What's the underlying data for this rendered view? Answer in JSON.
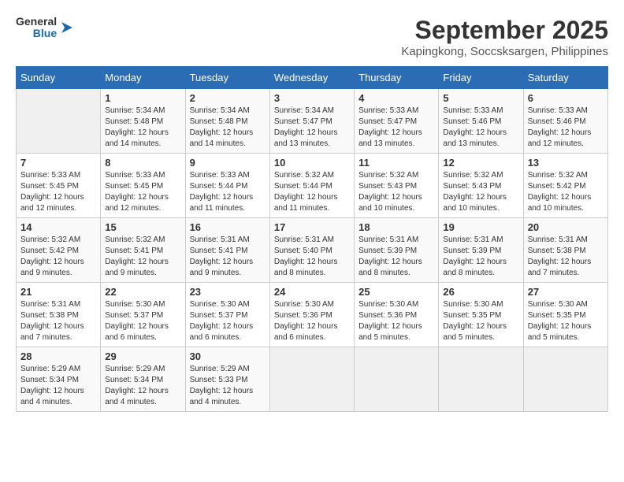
{
  "header": {
    "logo_line1": "General",
    "logo_line2": "Blue",
    "month": "September 2025",
    "location": "Kapingkong, Soccsksargen, Philippines"
  },
  "weekdays": [
    "Sunday",
    "Monday",
    "Tuesday",
    "Wednesday",
    "Thursday",
    "Friday",
    "Saturday"
  ],
  "weeks": [
    [
      {
        "day": "",
        "sunrise": "",
        "sunset": "",
        "daylight": ""
      },
      {
        "day": "1",
        "sunrise": "5:34 AM",
        "sunset": "5:48 PM",
        "daylight": "12 hours and 14 minutes."
      },
      {
        "day": "2",
        "sunrise": "5:34 AM",
        "sunset": "5:48 PM",
        "daylight": "12 hours and 14 minutes."
      },
      {
        "day": "3",
        "sunrise": "5:34 AM",
        "sunset": "5:47 PM",
        "daylight": "12 hours and 13 minutes."
      },
      {
        "day": "4",
        "sunrise": "5:33 AM",
        "sunset": "5:47 PM",
        "daylight": "12 hours and 13 minutes."
      },
      {
        "day": "5",
        "sunrise": "5:33 AM",
        "sunset": "5:46 PM",
        "daylight": "12 hours and 13 minutes."
      },
      {
        "day": "6",
        "sunrise": "5:33 AM",
        "sunset": "5:46 PM",
        "daylight": "12 hours and 12 minutes."
      }
    ],
    [
      {
        "day": "7",
        "sunrise": "5:33 AM",
        "sunset": "5:45 PM",
        "daylight": "12 hours and 12 minutes."
      },
      {
        "day": "8",
        "sunrise": "5:33 AM",
        "sunset": "5:45 PM",
        "daylight": "12 hours and 12 minutes."
      },
      {
        "day": "9",
        "sunrise": "5:33 AM",
        "sunset": "5:44 PM",
        "daylight": "12 hours and 11 minutes."
      },
      {
        "day": "10",
        "sunrise": "5:32 AM",
        "sunset": "5:44 PM",
        "daylight": "12 hours and 11 minutes."
      },
      {
        "day": "11",
        "sunrise": "5:32 AM",
        "sunset": "5:43 PM",
        "daylight": "12 hours and 10 minutes."
      },
      {
        "day": "12",
        "sunrise": "5:32 AM",
        "sunset": "5:43 PM",
        "daylight": "12 hours and 10 minutes."
      },
      {
        "day": "13",
        "sunrise": "5:32 AM",
        "sunset": "5:42 PM",
        "daylight": "12 hours and 10 minutes."
      }
    ],
    [
      {
        "day": "14",
        "sunrise": "5:32 AM",
        "sunset": "5:42 PM",
        "daylight": "12 hours and 9 minutes."
      },
      {
        "day": "15",
        "sunrise": "5:32 AM",
        "sunset": "5:41 PM",
        "daylight": "12 hours and 9 minutes."
      },
      {
        "day": "16",
        "sunrise": "5:31 AM",
        "sunset": "5:41 PM",
        "daylight": "12 hours and 9 minutes."
      },
      {
        "day": "17",
        "sunrise": "5:31 AM",
        "sunset": "5:40 PM",
        "daylight": "12 hours and 8 minutes."
      },
      {
        "day": "18",
        "sunrise": "5:31 AM",
        "sunset": "5:39 PM",
        "daylight": "12 hours and 8 minutes."
      },
      {
        "day": "19",
        "sunrise": "5:31 AM",
        "sunset": "5:39 PM",
        "daylight": "12 hours and 8 minutes."
      },
      {
        "day": "20",
        "sunrise": "5:31 AM",
        "sunset": "5:38 PM",
        "daylight": "12 hours and 7 minutes."
      }
    ],
    [
      {
        "day": "21",
        "sunrise": "5:31 AM",
        "sunset": "5:38 PM",
        "daylight": "12 hours and 7 minutes."
      },
      {
        "day": "22",
        "sunrise": "5:30 AM",
        "sunset": "5:37 PM",
        "daylight": "12 hours and 6 minutes."
      },
      {
        "day": "23",
        "sunrise": "5:30 AM",
        "sunset": "5:37 PM",
        "daylight": "12 hours and 6 minutes."
      },
      {
        "day": "24",
        "sunrise": "5:30 AM",
        "sunset": "5:36 PM",
        "daylight": "12 hours and 6 minutes."
      },
      {
        "day": "25",
        "sunrise": "5:30 AM",
        "sunset": "5:36 PM",
        "daylight": "12 hours and 5 minutes."
      },
      {
        "day": "26",
        "sunrise": "5:30 AM",
        "sunset": "5:35 PM",
        "daylight": "12 hours and 5 minutes."
      },
      {
        "day": "27",
        "sunrise": "5:30 AM",
        "sunset": "5:35 PM",
        "daylight": "12 hours and 5 minutes."
      }
    ],
    [
      {
        "day": "28",
        "sunrise": "5:29 AM",
        "sunset": "5:34 PM",
        "daylight": "12 hours and 4 minutes."
      },
      {
        "day": "29",
        "sunrise": "5:29 AM",
        "sunset": "5:34 PM",
        "daylight": "12 hours and 4 minutes."
      },
      {
        "day": "30",
        "sunrise": "5:29 AM",
        "sunset": "5:33 PM",
        "daylight": "12 hours and 4 minutes."
      },
      {
        "day": "",
        "sunrise": "",
        "sunset": "",
        "daylight": ""
      },
      {
        "day": "",
        "sunrise": "",
        "sunset": "",
        "daylight": ""
      },
      {
        "day": "",
        "sunrise": "",
        "sunset": "",
        "daylight": ""
      },
      {
        "day": "",
        "sunrise": "",
        "sunset": "",
        "daylight": ""
      }
    ]
  ]
}
